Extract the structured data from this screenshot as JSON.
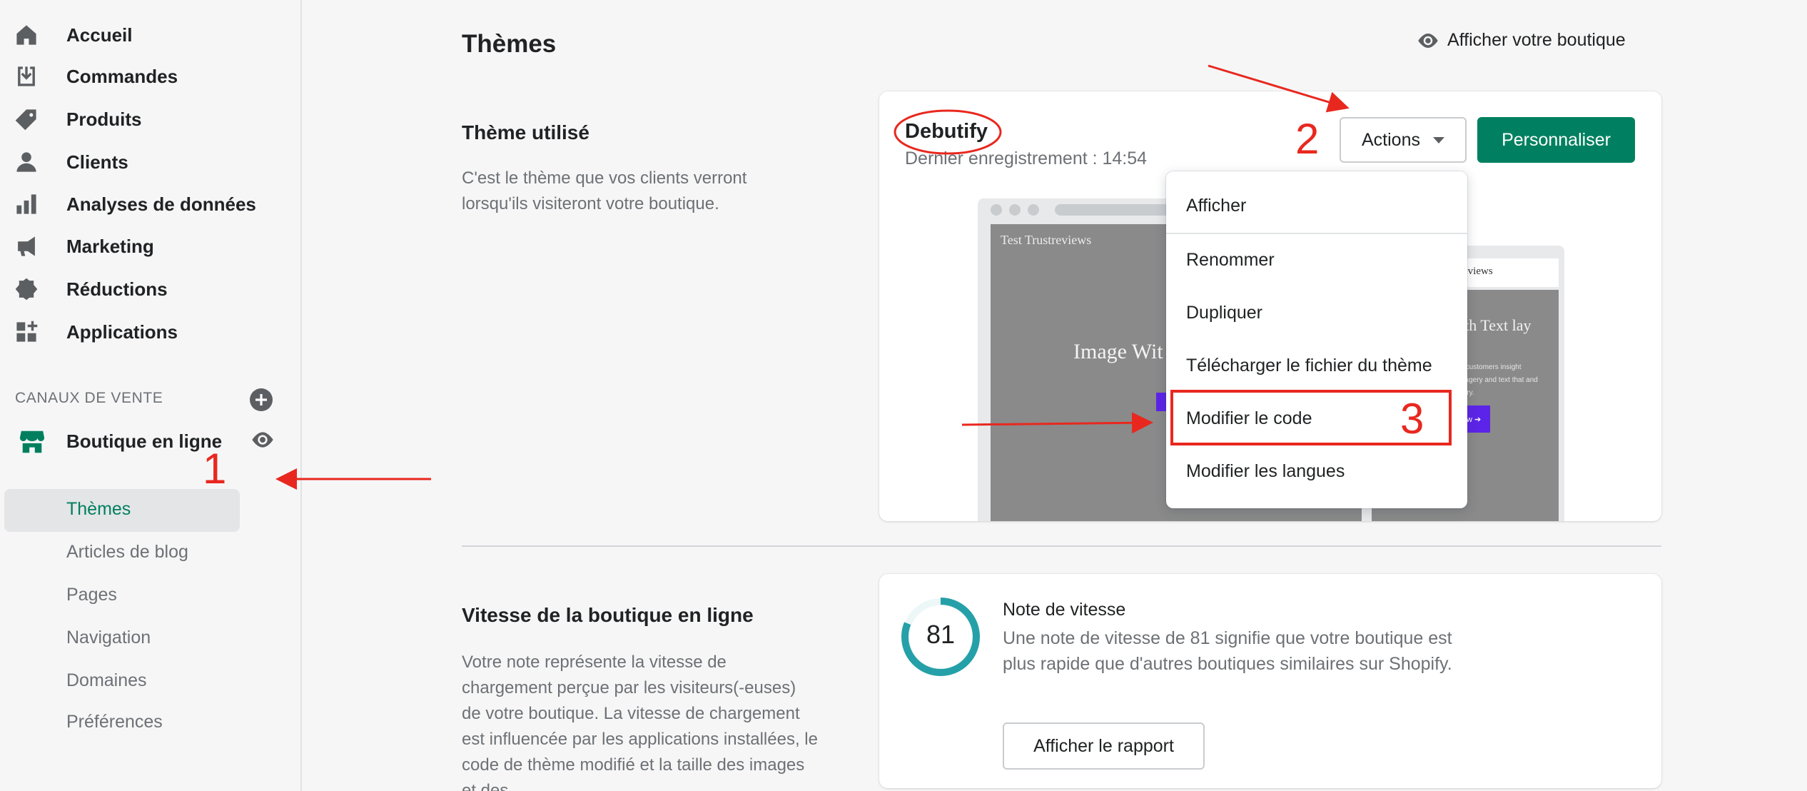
{
  "sidebar": {
    "items": [
      {
        "label": "Accueil",
        "icon": "home-icon"
      },
      {
        "label": "Commandes",
        "icon": "orders-icon"
      },
      {
        "label": "Produits",
        "icon": "tag-icon"
      },
      {
        "label": "Clients",
        "icon": "person-icon"
      },
      {
        "label": "Analyses de données",
        "icon": "bar-chart-icon"
      },
      {
        "label": "Marketing",
        "icon": "megaphone-icon"
      },
      {
        "label": "Réductions",
        "icon": "discount-icon"
      },
      {
        "label": "Applications",
        "icon": "apps-icon"
      }
    ],
    "channels_title": "CANAUX DE VENTE",
    "online_store_label": "Boutique en ligne",
    "sub_items": [
      "Thèmes",
      "Articles de blog",
      "Pages",
      "Navigation",
      "Domaines",
      "Préférences"
    ],
    "active_sub": "Thèmes"
  },
  "header": {
    "title": "Thèmes",
    "view_store": "Afficher votre boutique"
  },
  "current_theme": {
    "section_title": "Thème utilisé",
    "section_desc": "C'est le thème que vos clients verront lorsqu'ils visiteront votre boutique.",
    "name": "Debutify",
    "last_saved": "Dernier enregistrement : 14:54",
    "actions_label": "Actions",
    "customize_label": "Personnaliser",
    "preview": {
      "brand": "Test Trustreviews",
      "heading": "Image Wit",
      "mobile_brand": "eviews",
      "mobile_heading": "ith Text lay",
      "mobile_text": "ur customers insight imagery and text that and story.",
      "mobile_button": "ow ➔"
    },
    "dropdown": [
      "Afficher",
      "Renommer",
      "Dupliquer",
      "Télécharger le fichier du thème",
      "Modifier le code",
      "Modifier les langues"
    ]
  },
  "speed": {
    "section_title": "Vitesse de la boutique en ligne",
    "section_desc": "Votre note représente la vitesse de chargement perçue par les visiteurs(-euses) de votre boutique. La vitesse de chargement est influencée par les applications installées, le code de thème modifié et la taille des images et des",
    "score": "81",
    "score_value": 81,
    "title": "Note de vitesse",
    "description": "Une note de vitesse de 81 signifie que votre boutique est plus rapide que d'autres boutiques similaires sur Shopify.",
    "report_button": "Afficher le rapport"
  },
  "annotations": {
    "step1": "1",
    "step2": "2",
    "step3": "3"
  },
  "colors": {
    "primary": "#008060",
    "annotation": "#e8281f",
    "active_text": "#007f5f",
    "gauge": "#25a0a8"
  }
}
